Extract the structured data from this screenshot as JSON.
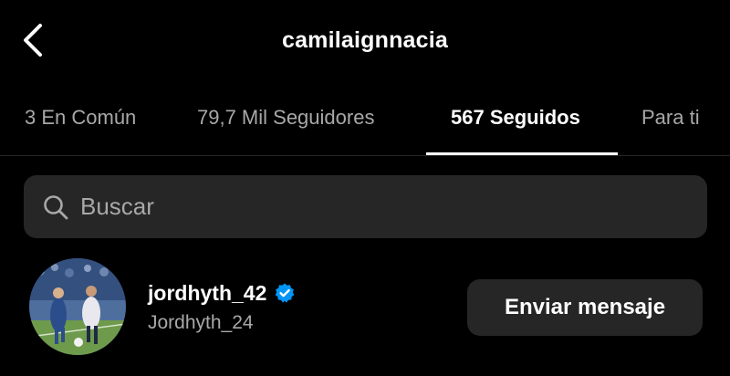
{
  "header": {
    "back_icon": "chevron-left-icon",
    "title": "camilaignnacia"
  },
  "tabs": [
    {
      "label": "3 En Común",
      "active": false
    },
    {
      "label": "79,7 Mil Seguidores",
      "active": false
    },
    {
      "label": "567 Seguidos",
      "active": true
    },
    {
      "label": "Para ti",
      "active": false
    }
  ],
  "search": {
    "icon": "search-icon",
    "placeholder": "Buscar",
    "value": ""
  },
  "following": [
    {
      "username": "jordhyth_42",
      "full_name": "Jordhyth_24",
      "verified": true,
      "verified_icon": "verified-badge-icon",
      "button_label": "Enviar mensaje"
    }
  ],
  "colors": {
    "background": "#000000",
    "text_primary": "#ffffff",
    "text_secondary": "#a8a8a8",
    "surface": "#262626",
    "verified_blue": "#0095f6"
  }
}
